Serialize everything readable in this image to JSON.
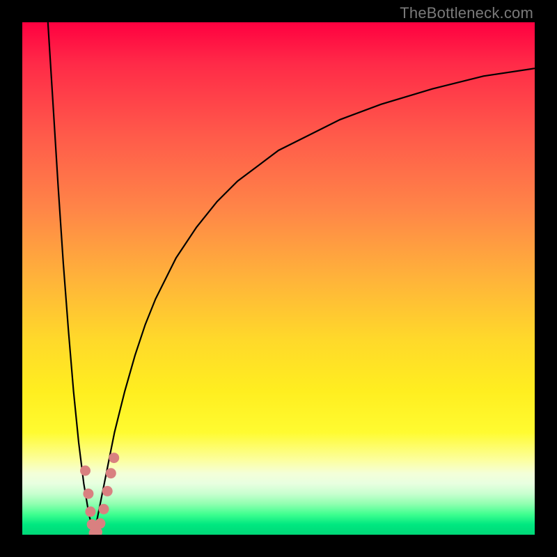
{
  "watermark": "TheBottleneck.com",
  "colors": {
    "frame": "#000000",
    "curve_stroke": "#000000",
    "marker_fill": "#d98080",
    "watermark_text": "#7a7a7a"
  },
  "chart_data": {
    "type": "line",
    "title": "",
    "xlabel": "",
    "ylabel": "",
    "xlim": [
      0,
      100
    ],
    "ylim": [
      0,
      100
    ],
    "grid": false,
    "legend": false,
    "series": [
      {
        "name": "left-branch",
        "x": [
          5,
          6,
          7,
          8,
          9,
          10,
          11,
          12,
          13,
          14
        ],
        "y": [
          100,
          84,
          68,
          53,
          40,
          28,
          18,
          10,
          4,
          0
        ]
      },
      {
        "name": "right-branch",
        "x": [
          14,
          15,
          16,
          17,
          18,
          19,
          20,
          22,
          24,
          26,
          28,
          30,
          34,
          38,
          42,
          46,
          50,
          56,
          62,
          70,
          80,
          90,
          100
        ],
        "y": [
          0,
          5,
          10,
          15,
          20,
          24,
          28,
          35,
          41,
          46,
          50,
          54,
          60,
          65,
          69,
          72,
          75,
          78,
          81,
          84,
          87,
          89.5,
          91
        ]
      }
    ],
    "markers": {
      "name": "highlight-points",
      "fill": "#d98080",
      "points": [
        {
          "x": 12.3,
          "y": 12.5
        },
        {
          "x": 12.9,
          "y": 8.0
        },
        {
          "x": 13.3,
          "y": 4.5
        },
        {
          "x": 13.6,
          "y": 2.0
        },
        {
          "x": 14.0,
          "y": 0.3
        },
        {
          "x": 14.6,
          "y": 0.5
        },
        {
          "x": 15.2,
          "y": 2.2
        },
        {
          "x": 15.9,
          "y": 5.0
        },
        {
          "x": 16.6,
          "y": 8.5
        },
        {
          "x": 17.3,
          "y": 12.0
        },
        {
          "x": 17.9,
          "y": 15.0
        }
      ]
    }
  }
}
